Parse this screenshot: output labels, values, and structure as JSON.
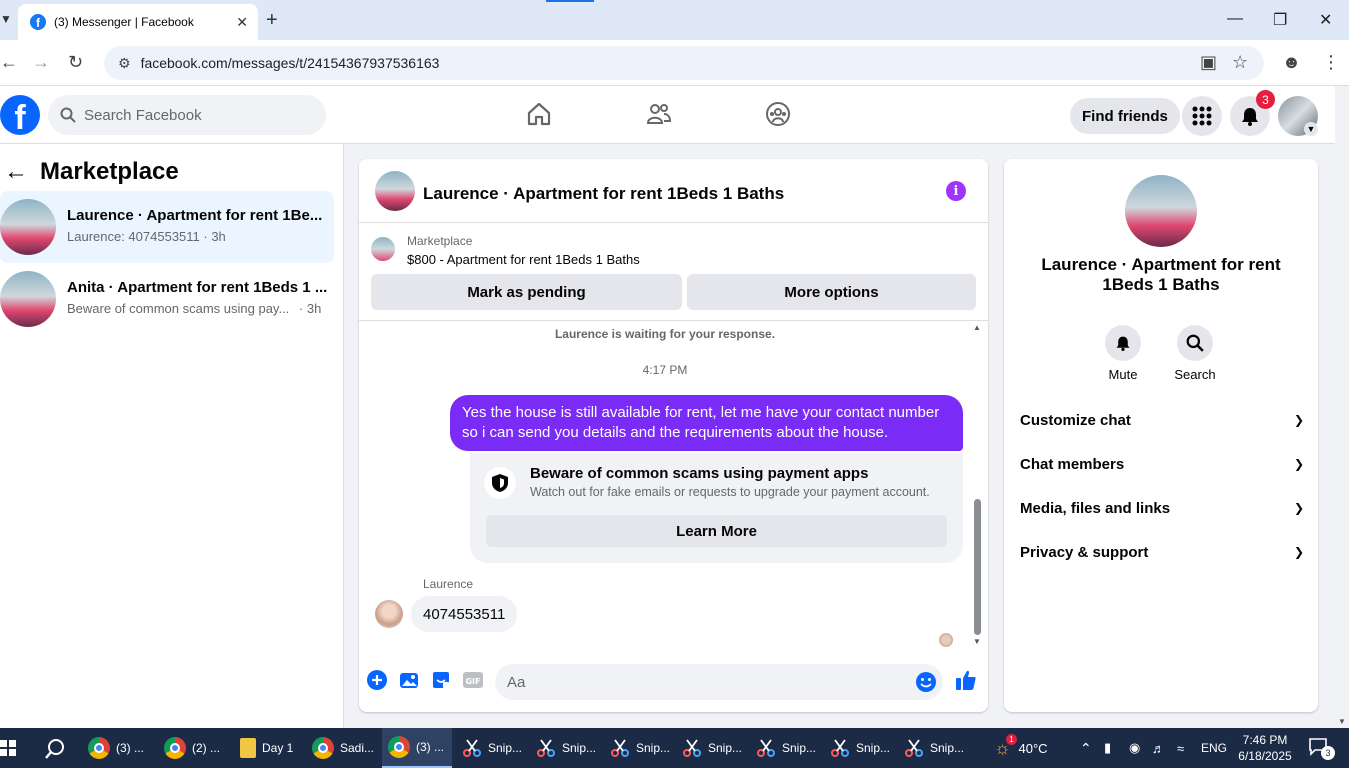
{
  "browser": {
    "tab_title": "(3) Messenger | Facebook",
    "url": "facebook.com/messages/t/24154367937536163"
  },
  "fb": {
    "search_placeholder": "Search Facebook",
    "find_friends": "Find friends",
    "notification_count": "3"
  },
  "sidebar": {
    "title": "Marketplace",
    "items": [
      {
        "name": "Laurence · Apartment for rent 1Be...",
        "sub": "Laurence: 4074553511 · 3h"
      },
      {
        "name": "Anita · Apartment for rent 1Beds 1 ...",
        "sub": "Beware of common scams using pay...",
        "time": "· 3h"
      }
    ]
  },
  "chat": {
    "title": "Laurence · Apartment for rent 1Beds 1 Baths",
    "listing_label": "Marketplace",
    "listing_price": "$800 - Apartment for rent 1Beds 1 Baths",
    "mark_pending": "Mark as pending",
    "more_options": "More options",
    "waiting": "Laurence is waiting for your response.",
    "time": "4:17 PM",
    "my_message": "Yes the house is still available for rent, let me have your contact number so i can send you details and the requirements about the house.",
    "scam_title": "Beware of common scams using payment apps",
    "scam_sub": "Watch out for fake emails or requests to upgrade your payment account.",
    "learn_more": "Learn More",
    "sender": "Laurence",
    "their_message": "4074553511",
    "composer_placeholder": "Aa"
  },
  "right": {
    "name": "Laurence · Apartment for rent 1Beds 1 Baths",
    "mute": "Mute",
    "search": "Search",
    "rows": [
      "Customize chat",
      "Chat members",
      "Media, files and links",
      "Privacy & support"
    ]
  },
  "taskbar": {
    "items": [
      "(3) ...",
      "(2) ...",
      "Day 1",
      "Sadi...",
      "(3) ...",
      "Snip...",
      "Snip...",
      "Snip...",
      "Snip...",
      "Snip...",
      "Snip...",
      "Snip..."
    ],
    "weather": "40°C",
    "weather_badge": "1",
    "lang": "ENG",
    "time": "7:46 PM",
    "date": "6/18/2025",
    "notif_count": "3"
  },
  "colors": {
    "fb_blue": "#0866ff",
    "my_bubble": "#7a2bf6",
    "taskbar": "#1c2b45"
  }
}
